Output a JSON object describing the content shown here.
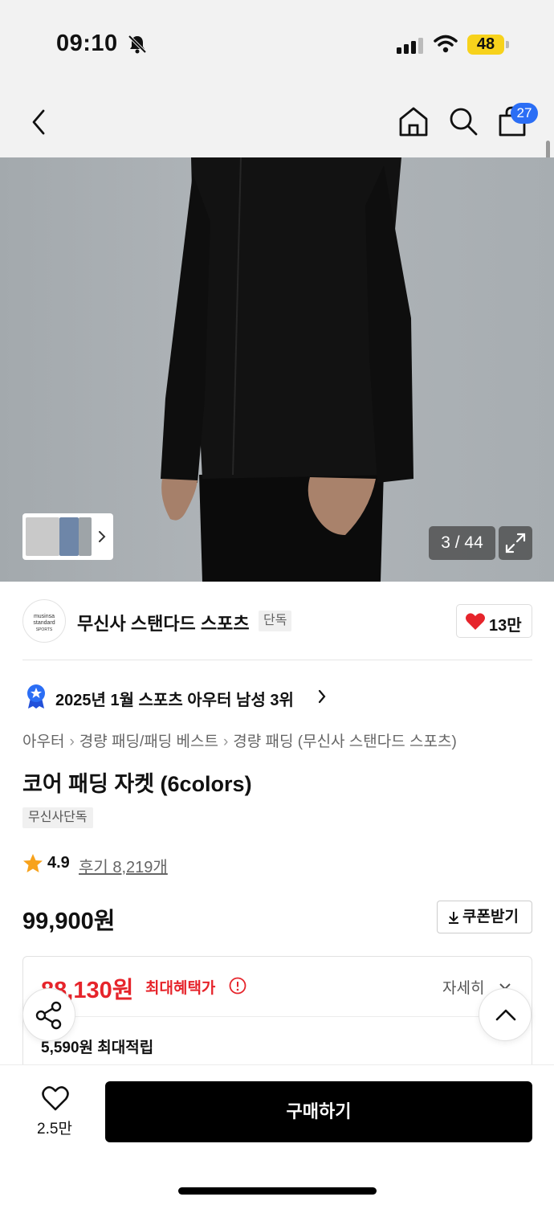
{
  "status_bar": {
    "time": "09:10",
    "battery": "48"
  },
  "nav": {
    "cart_count": "27"
  },
  "gallery": {
    "counter": "3 / 44"
  },
  "brand": {
    "logo_line1": "musinsa",
    "logo_line2": "standard",
    "logo_line3": "SPORTS",
    "name": "무신사 스탠다드 스포츠",
    "tag": "단독",
    "likes": "13만"
  },
  "ranking": {
    "text": "2025년 1월 스포츠 아우터 남성 3위"
  },
  "breadcrumb": {
    "items": [
      "아우터",
      "경량 패딩/패딩 베스트",
      "경량 패딩 (무신사 스탠다드 스포츠)"
    ]
  },
  "product": {
    "title": "코어 패딩 자켓 (6colors)",
    "exclusive_tag": "무신사단독",
    "rating": "4.9",
    "reviews": "후기 8,219개",
    "price": "99,900원",
    "coupon_label": "쿠폰받기"
  },
  "benefit": {
    "price": "88,130원",
    "label": "최대혜택가",
    "details_label": "자세히",
    "points": "5,590원 최대적립"
  },
  "bottom": {
    "wish_count": "2.5만",
    "buy_label": "구매하기"
  },
  "colors": {
    "accent_red": "#e6242b",
    "badge_blue": "#2b6ef5",
    "battery_yellow": "#f7d21c"
  }
}
